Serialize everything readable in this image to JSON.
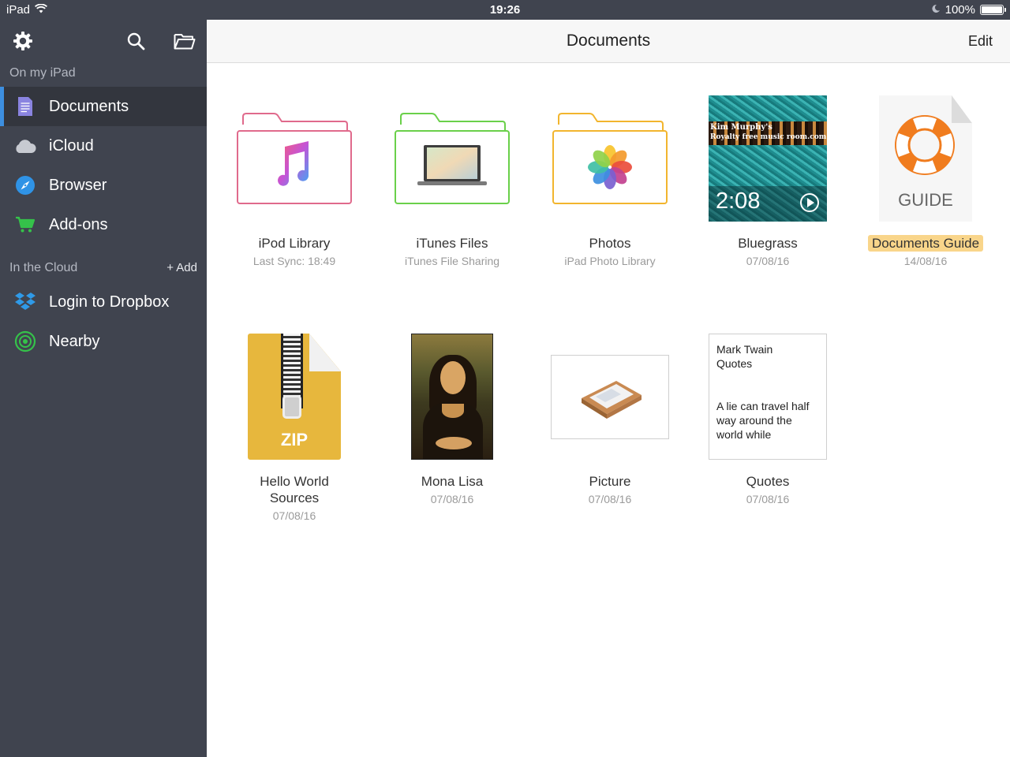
{
  "status_bar": {
    "device": "iPad",
    "time": "19:26",
    "battery": "100%"
  },
  "sidebar": {
    "section_local": "On my iPad",
    "items_local": [
      {
        "label": "Documents",
        "icon": "document-icon",
        "active": true
      },
      {
        "label": "iCloud",
        "icon": "cloud-icon"
      },
      {
        "label": "Browser",
        "icon": "compass-icon"
      },
      {
        "label": "Add-ons",
        "icon": "cart-icon"
      }
    ],
    "section_cloud": "In the Cloud",
    "add_label": "+ Add",
    "items_cloud": [
      {
        "label": "Login to Dropbox",
        "icon": "dropbox-icon"
      },
      {
        "label": "Nearby",
        "icon": "nearby-icon"
      }
    ]
  },
  "navbar": {
    "title": "Documents",
    "edit_label": "Edit"
  },
  "files": [
    {
      "name": "iPod Library",
      "sub": "Last Sync: 18:49",
      "icon": "music-folder-icon"
    },
    {
      "name": "iTunes Files",
      "sub": "iTunes File Sharing",
      "icon": "laptop-folder-icon"
    },
    {
      "name": "Photos",
      "sub": "iPad Photo Library",
      "icon": "photos-folder-icon"
    },
    {
      "name": "Bluegrass",
      "sub": "07/08/16",
      "icon": "video-thumbnail",
      "duration": "2:08",
      "banner_line1": "Kim Murphy's",
      "banner_line2": "Royalty free music room.com"
    },
    {
      "name": "Documents Guide",
      "sub": "14/08/16",
      "icon": "guide-doc-icon",
      "doc_label": "GUIDE",
      "highlighted": true
    },
    {
      "name": "Hello World Sources",
      "sub": "07/08/16",
      "icon": "zip-icon",
      "doc_label": "ZIP"
    },
    {
      "name": "Mona Lisa",
      "sub": "07/08/16",
      "icon": "image-thumbnail"
    },
    {
      "name": "Picture",
      "sub": "07/08/16",
      "icon": "picture-thumbnail"
    },
    {
      "name": "Quotes",
      "sub": "07/08/16",
      "icon": "text-thumbnail",
      "preview_title": "Mark Twain Quotes",
      "preview_body": "A lie can travel half way around the world while"
    }
  ],
  "colors": {
    "sidebar_bg": "#40444f",
    "sidebar_active": "#33363e",
    "accent": "#3d8fe0",
    "highlight": "#f9d58a"
  }
}
